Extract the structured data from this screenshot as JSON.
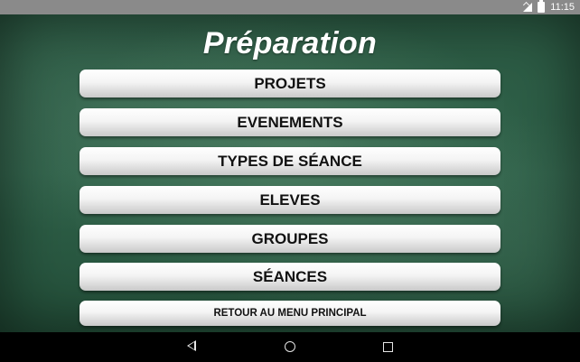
{
  "status_bar": {
    "time": "11:15",
    "icons": [
      "signal-icon",
      "battery-icon"
    ]
  },
  "screen": {
    "title": "Préparation",
    "menu": [
      {
        "label": "PROJETS"
      },
      {
        "label": "EVENEMENTS"
      },
      {
        "label": "TYPES DE SÉANCE"
      },
      {
        "label": "ELEVES"
      },
      {
        "label": "GROUPES"
      },
      {
        "label": "SÉANCES"
      },
      {
        "label": "RETOUR AU MENU PRINCIPAL"
      }
    ]
  },
  "nav_bar": {
    "icons": [
      "back-icon",
      "home-icon",
      "recents-icon"
    ]
  },
  "colors": {
    "board": "#2f6149",
    "button_top": "#ffffff",
    "button_bottom": "#c9c9c9",
    "status_bar": "#8a8a8a"
  }
}
